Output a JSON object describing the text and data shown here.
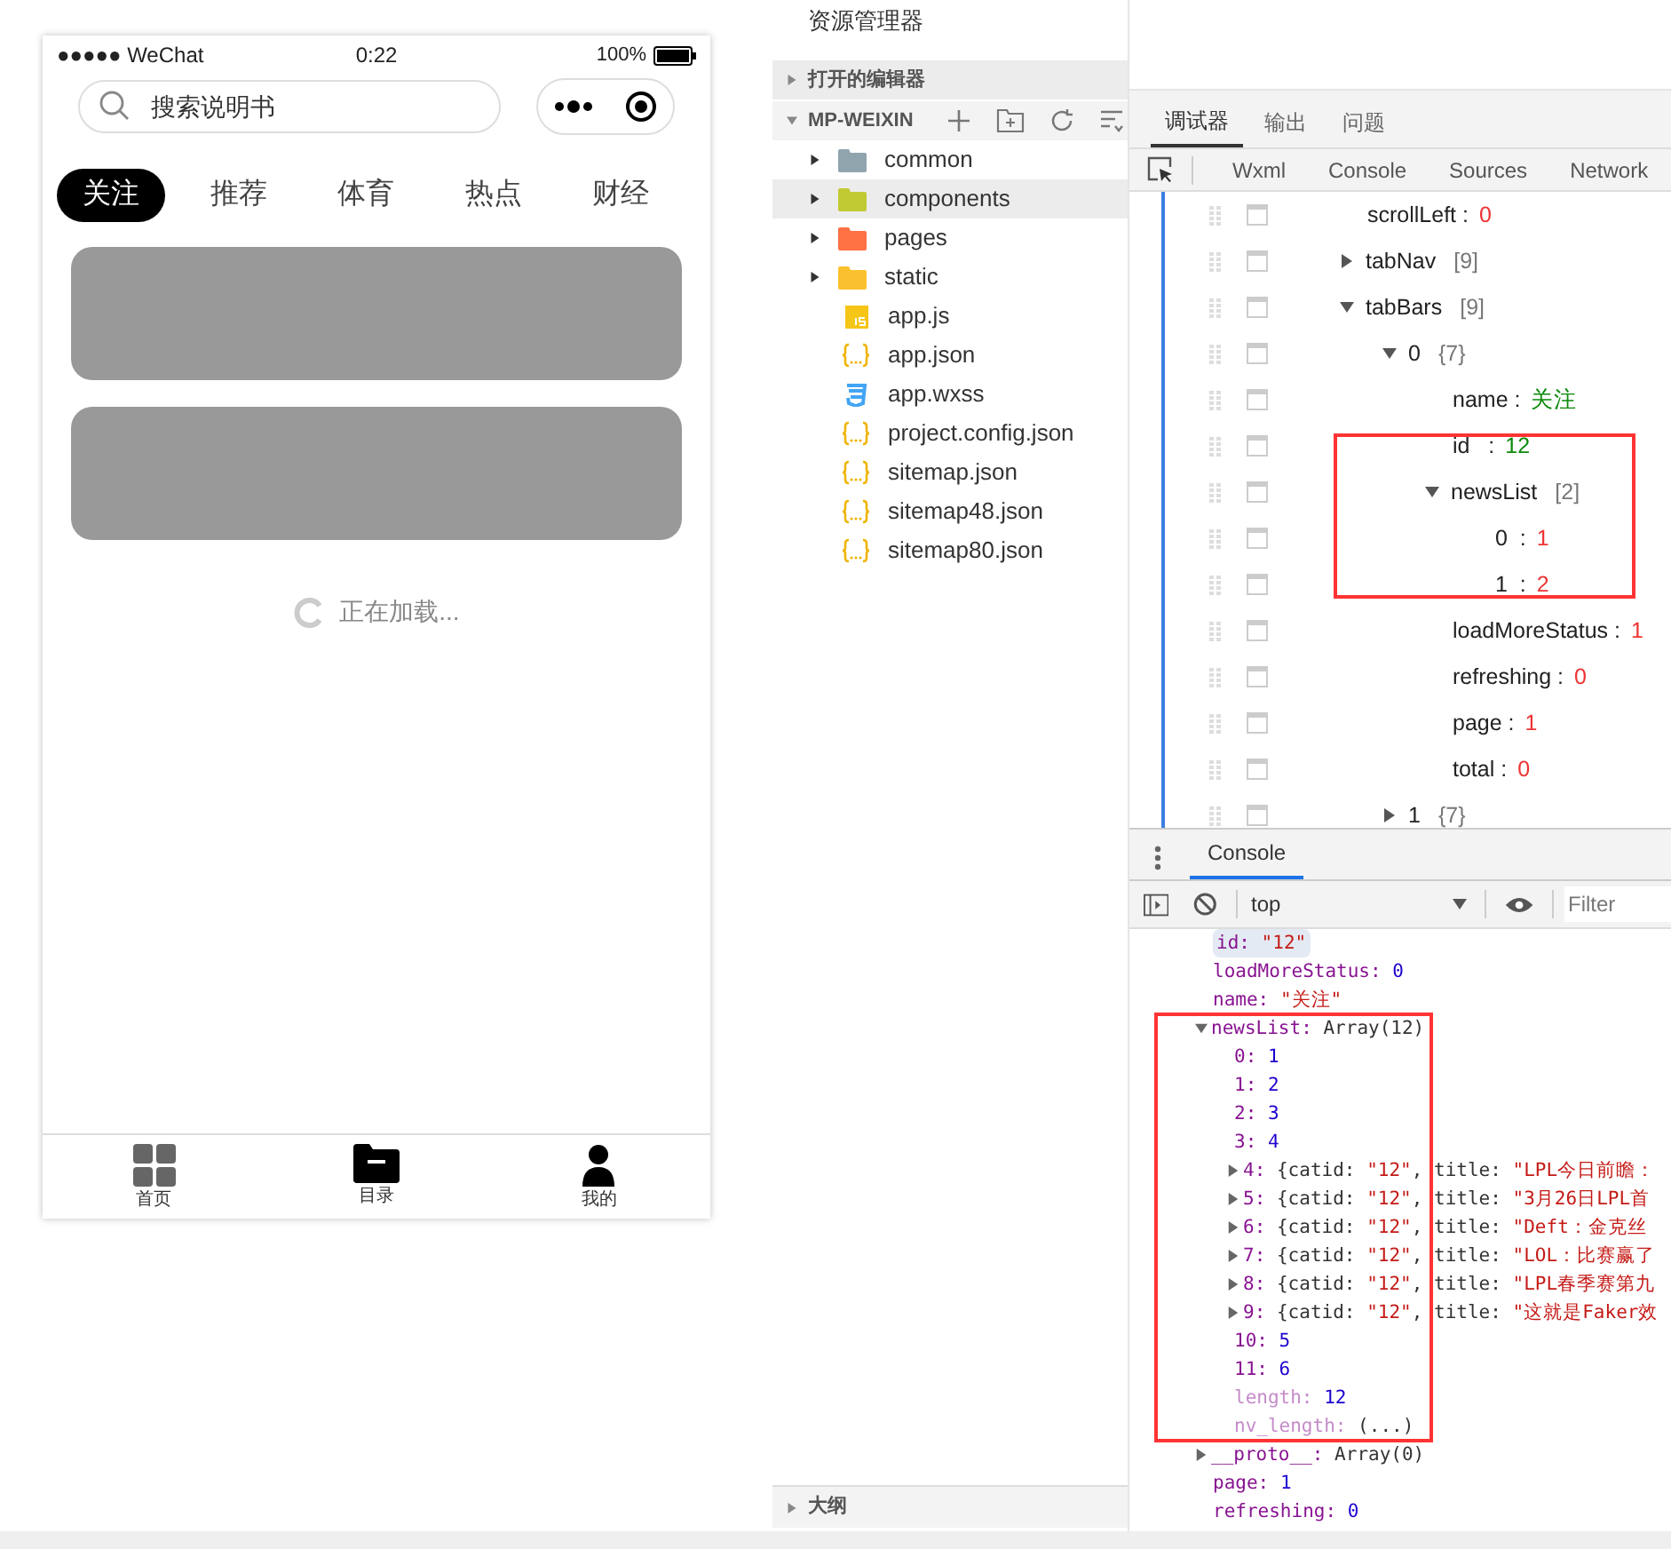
{
  "phone": {
    "status_bar": {
      "carrier": "●●●●● WeChat",
      "time": "0:22",
      "battery": "100%"
    },
    "search": {
      "placeholder": "搜索说明书"
    },
    "tabs": [
      {
        "label": "关注",
        "selected": true
      },
      {
        "label": "推荐",
        "selected": false
      },
      {
        "label": "体育",
        "selected": false
      },
      {
        "label": "热点",
        "selected": false
      },
      {
        "label": "财经",
        "selected": false
      }
    ],
    "cards": [
      {
        "kind": "placeholder"
      },
      {
        "kind": "placeholder"
      }
    ],
    "loading": "正在加载...",
    "tab_bar": [
      {
        "label": "首页",
        "kind": "grid",
        "selected": false
      },
      {
        "label": "目录",
        "kind": "folder",
        "selected": true
      },
      {
        "label": "我的",
        "kind": "user",
        "selected": true
      }
    ]
  },
  "explorer": {
    "title": "资源管理器",
    "open_editors": {
      "label": "打开的编辑器",
      "expanded": false
    },
    "project": {
      "label": "MP-WEIXIN",
      "expanded": true
    },
    "files": [
      {
        "name": "common",
        "kind": "folder",
        "color": "#90a4ae",
        "selected": false
      },
      {
        "name": "components",
        "kind": "folder",
        "color": "#c0ca33",
        "selected": true
      },
      {
        "name": "pages",
        "kind": "folder",
        "color": "#ff7043",
        "selected": false
      },
      {
        "name": "static",
        "kind": "folder",
        "color": "#fbc02d",
        "selected": false
      },
      {
        "name": "app.js",
        "kind": "js",
        "selected": false
      },
      {
        "name": "app.json",
        "kind": "json",
        "selected": false
      },
      {
        "name": "app.wxss",
        "kind": "css",
        "selected": false
      },
      {
        "name": "project.config.json",
        "kind": "json",
        "selected": false
      },
      {
        "name": "sitemap.json",
        "kind": "json",
        "selected": false
      },
      {
        "name": "sitemap48.json",
        "kind": "json",
        "selected": false
      },
      {
        "name": "sitemap80.json",
        "kind": "json",
        "selected": false
      }
    ],
    "outline": {
      "label": "大纲",
      "expanded": false
    }
  },
  "debugger": {
    "tabs": [
      {
        "label": "调试器",
        "selected": true
      },
      {
        "label": "输出",
        "selected": false
      },
      {
        "label": "问题",
        "selected": false
      }
    ],
    "panels": [
      "Wxml",
      "Console",
      "Sources",
      "Network"
    ],
    "tree": [
      {
        "kind": "number",
        "key": "scrollLeft :",
        "value": "0",
        "checked": false
      },
      {
        "kind": "object",
        "key": "tabNav",
        "value": "[9]",
        "expanded": false,
        "checked": false
      },
      {
        "kind": "object",
        "key": "tabBars",
        "value": "[9]",
        "expanded": true,
        "checked": false,
        "children": [
          {
            "kind": "object",
            "key": "0",
            "value": "{7}",
            "expanded": true,
            "checked": false,
            "children": [
              {
                "kind": "string",
                "key": "name :",
                "value": "关注",
                "checked": false
              },
              {
                "kind": "string",
                "key": "id   :",
                "value": "12",
                "checked": false
              },
              {
                "kind": "object",
                "key": "newsList",
                "value": "[2]",
                "expanded": true,
                "checked": false,
                "children": [
                  {
                    "kind": "number",
                    "key": "0  :",
                    "value": "1",
                    "checked": false
                  },
                  {
                    "kind": "number",
                    "key": "1  :",
                    "value": "2",
                    "checked": false
                  }
                ]
              },
              {
                "kind": "number",
                "key": "loadMoreStatus :",
                "value": "1",
                "checked": false
              },
              {
                "kind": "number",
                "key": "refreshing :",
                "value": "0",
                "checked": false
              },
              {
                "kind": "number",
                "key": "page :",
                "value": "1",
                "checked": false
              },
              {
                "kind": "number",
                "key": "total :",
                "value": "0",
                "checked": false
              }
            ]
          },
          {
            "kind": "object",
            "key": "1",
            "value": "{7}",
            "expanded": false,
            "checked": false
          }
        ]
      }
    ]
  },
  "console": {
    "tab": {
      "label": "Console",
      "selected": true
    },
    "context": "top",
    "filter": {
      "placeholder": "Filter"
    },
    "lines": [
      {
        "kind": "string",
        "key": "id:",
        "value": "\"12\"",
        "selected": true
      },
      {
        "kind": "number",
        "key": "loadMoreStatus:",
        "value": "0",
        "selected": false
      },
      {
        "kind": "string",
        "key": "name:",
        "value": "\"关注\"",
        "selected": false
      },
      {
        "kind": "object",
        "key": "newsList:",
        "value": "Array(12)",
        "expanded": true,
        "selected": false,
        "children": [
          {
            "kind": "number",
            "key": "0:",
            "value": "1"
          },
          {
            "kind": "number",
            "key": "1:",
            "value": "2"
          },
          {
            "kind": "number",
            "key": "2:",
            "value": "3"
          },
          {
            "kind": "number",
            "key": "3:",
            "value": "4"
          },
          {
            "kind": "record",
            "key": "4:",
            "catid_label": "{catid:",
            "catid": "\"12\"",
            "title_label": ", title:",
            "title": "\"LPL今日前瞻：",
            "expanded": false
          },
          {
            "kind": "record",
            "key": "5:",
            "catid_label": "{catid:",
            "catid": "\"12\"",
            "title_label": ", title:",
            "title": "\"3月26日LPL首",
            "expanded": false
          },
          {
            "kind": "record",
            "key": "6:",
            "catid_label": "{catid:",
            "catid": "\"12\"",
            "title_label": ", title:",
            "title": "\"Deft：金克丝",
            "expanded": false
          },
          {
            "kind": "record",
            "key": "7:",
            "catid_label": "{catid:",
            "catid": "\"12\"",
            "title_label": ", title:",
            "title": "\"LOL：比赛赢了",
            "expanded": false
          },
          {
            "kind": "record",
            "key": "8:",
            "catid_label": "{catid:",
            "catid": "\"12\"",
            "title_label": ", title:",
            "title": "\"LPL春季赛第九",
            "expanded": false
          },
          {
            "kind": "record",
            "key": "9:",
            "catid_label": "{catid:",
            "catid": "\"12\"",
            "title_label": ", title:",
            "title": "\"这就是Faker效",
            "expanded": false
          },
          {
            "kind": "number",
            "key": "10:",
            "value": "5"
          },
          {
            "kind": "number",
            "key": "11:",
            "value": "6"
          },
          {
            "kind": "meta",
            "key": "length:",
            "value": "12"
          },
          {
            "kind": "getter",
            "key": "nv_length:",
            "value": "(...)"
          }
        ]
      },
      {
        "kind": "object",
        "key": "__proto__:",
        "value": "Array(0)",
        "expanded": false,
        "selected": false
      },
      {
        "kind": "number",
        "key": "page:",
        "value": "1",
        "selected": false
      },
      {
        "kind": "number",
        "key": "refreshing:",
        "value": "0",
        "selected": false
      }
    ]
  }
}
